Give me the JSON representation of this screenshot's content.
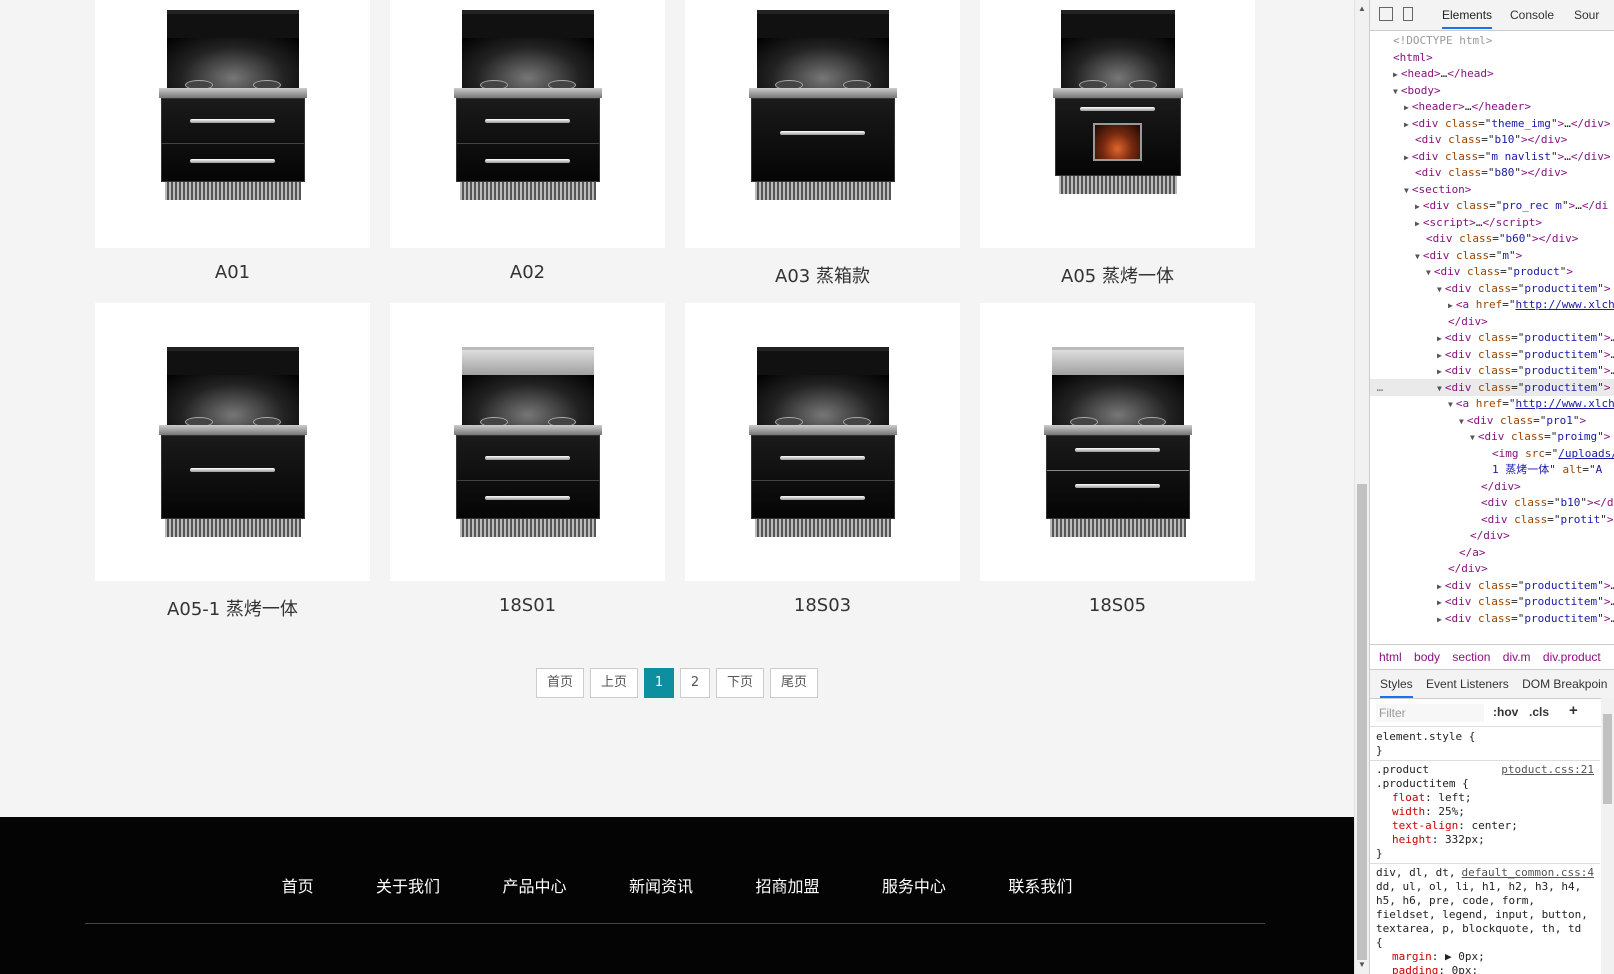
{
  "products": [
    {
      "title": "A01",
      "variant": "hood-2drawer"
    },
    {
      "title": "A02",
      "variant": "hood-2drawer"
    },
    {
      "title": "A03 蒸箱款",
      "variant": "hood-oven"
    },
    {
      "title": "A05 蒸烤一体",
      "variant": "tall-fire"
    },
    {
      "title": "A05-1 蒸烤一体",
      "variant": "hood-oven"
    },
    {
      "title": "18S01",
      "variant": "silver-2drawer"
    },
    {
      "title": "18S03",
      "variant": "hood-2drawer-b"
    },
    {
      "title": "18S05",
      "variant": "silver-window"
    }
  ],
  "pagination": {
    "first": "首页",
    "prev": "上页",
    "pages": [
      "1",
      "2"
    ],
    "current": "1",
    "next": "下页",
    "last": "尾页"
  },
  "footer_nav": [
    "首页",
    "关于我们",
    "产品中心",
    "新闻资讯",
    "招商加盟",
    "服务中心",
    "联系我们"
  ],
  "devtools": {
    "tabs": [
      "Elements",
      "Console",
      "Sour"
    ],
    "active_tab": "Elements",
    "tree": [
      {
        "indent": 0,
        "html": "<span class='cm'>&lt;!DOCTYPE html&gt;</span>"
      },
      {
        "indent": 0,
        "html": "<span class='tg'>&lt;html&gt;</span>"
      },
      {
        "indent": 1,
        "tri": "▶",
        "html": "<span class='tg'>&lt;head&gt;</span>…<span class='tg'>&lt;/head&gt;</span>"
      },
      {
        "indent": 1,
        "tri": "▼",
        "html": "<span class='tg'>&lt;body&gt;</span>"
      },
      {
        "indent": 2,
        "tri": "▶",
        "html": "<span class='tg'>&lt;header&gt;</span>…<span class='tg'>&lt;/header&gt;</span>"
      },
      {
        "indent": 2,
        "tri": "▶",
        "html": "<span class='tg'>&lt;div </span><span class='an'>class</span>=\"<span class='av'>theme_img</span>\"<span class='tg'>&gt;</span>…<span class='tg'>&lt;/div&gt;</span>"
      },
      {
        "indent": 2,
        "html": "<span class='tg'>&lt;div </span><span class='an'>class</span>=\"<span class='av'>b10</span>\"<span class='tg'>&gt;&lt;/div&gt;</span>"
      },
      {
        "indent": 2,
        "tri": "▶",
        "html": "<span class='tg'>&lt;div </span><span class='an'>class</span>=\"<span class='av'>m navlist</span>\"<span class='tg'>&gt;</span>…<span class='tg'>&lt;/div&gt;</span>"
      },
      {
        "indent": 2,
        "html": "<span class='tg'>&lt;div </span><span class='an'>class</span>=\"<span class='av'>b80</span>\"<span class='tg'>&gt;&lt;/div&gt;</span>"
      },
      {
        "indent": 2,
        "tri": "▼",
        "html": "<span class='tg'>&lt;section&gt;</span>"
      },
      {
        "indent": 3,
        "tri": "▶",
        "html": "<span class='tg'>&lt;div </span><span class='an'>class</span>=\"<span class='av'>pro_rec  m</span>\"<span class='tg'>&gt;</span>…<span class='tg'>&lt;/di</span>"
      },
      {
        "indent": 3,
        "tri": "▶",
        "html": "<span class='tg'>&lt;script&gt;</span>…<span class='tg'>&lt;/script&gt;</span>"
      },
      {
        "indent": 3,
        "html": "<span class='tg'>&lt;div </span><span class='an'>class</span>=\"<span class='av'>b60</span>\"<span class='tg'>&gt;&lt;/div&gt;</span>"
      },
      {
        "indent": 3,
        "tri": "▼",
        "html": "<span class='tg'>&lt;div </span><span class='an'>class</span>=\"<span class='av'>m</span>\"<span class='tg'>&gt;</span>"
      },
      {
        "indent": 4,
        "tri": "▼",
        "html": "<span class='tg'>&lt;div </span><span class='an'>class</span>=\"<span class='av'>product</span>\"<span class='tg'>&gt;</span>"
      },
      {
        "indent": 5,
        "tri": "▼",
        "html": "<span class='tg'>&lt;div </span><span class='an'>class</span>=\"<span class='av'>productitem</span>\"<span class='tg'>&gt;</span>"
      },
      {
        "indent": 6,
        "tri": "▶",
        "html": "<span class='tg'>&lt;a </span><span class='an'>href</span>=\"<span class='lk'>http://www.xlch</span>"
      },
      {
        "indent": 5,
        "html": "<span class='tg'>&lt;/div&gt;</span>"
      },
      {
        "indent": 5,
        "tri": "▶",
        "html": "<span class='tg'>&lt;div </span><span class='an'>class</span>=\"<span class='av'>productitem</span>\"<span class='tg'>&gt;</span>…"
      },
      {
        "indent": 5,
        "tri": "▶",
        "html": "<span class='tg'>&lt;div </span><span class='an'>class</span>=\"<span class='av'>productitem</span>\"<span class='tg'>&gt;</span>…"
      },
      {
        "indent": 5,
        "tri": "▶",
        "html": "<span class='tg'>&lt;div </span><span class='an'>class</span>=\"<span class='av'>productitem</span>\"<span class='tg'>&gt;</span>…"
      },
      {
        "indent": 5,
        "tri": "▼",
        "sel": true,
        "html": "<span class='tg'>&lt;div </span><span class='an'>class</span>=\"<span class='av'>productitem</span>\"<span class='tg'>&gt;</span>"
      },
      {
        "indent": 6,
        "tri": "▼",
        "html": "<span class='tg'>&lt;a </span><span class='an'>href</span>=\"<span class='lk'>http://www.xlch</span>"
      },
      {
        "indent": 7,
        "tri": "▼",
        "html": "<span class='tg'>&lt;div </span><span class='an'>class</span>=\"<span class='av'>pro1</span>\"<span class='tg'>&gt;</span>"
      },
      {
        "indent": 8,
        "tri": "▼",
        "html": "<span class='tg'>&lt;div </span><span class='an'>class</span>=\"<span class='av'>proimg</span>\"<span class='tg'>&gt;</span>"
      },
      {
        "indent": 9,
        "html": "<span class='tg'>&lt;img </span><span class='an'>src</span>=\"<span class='lk'>/uploads/</span>"
      },
      {
        "indent": 9,
        "html": "<span class='av'>1 蒸烤一体</span>\" <span class='an'>alt</span>=\"<span class='av'>A</span>"
      },
      {
        "indent": 8,
        "html": "<span class='tg'>&lt;/div&gt;</span>"
      },
      {
        "indent": 8,
        "html": "<span class='tg'>&lt;div </span><span class='an'>class</span>=\"<span class='av'>b10</span>\"<span class='tg'>&gt;&lt;/d</span>"
      },
      {
        "indent": 8,
        "html": "<span class='tg'>&lt;div </span><span class='an'>class</span>=\"<span class='av'>protit</span>\"<span class='tg'>&gt;</span>…"
      },
      {
        "indent": 7,
        "html": "<span class='tg'>&lt;/div&gt;</span>"
      },
      {
        "indent": 6,
        "html": "<span class='tg'>&lt;/a&gt;</span>"
      },
      {
        "indent": 5,
        "html": "<span class='tg'>&lt;/div&gt;</span>"
      },
      {
        "indent": 5,
        "tri": "▶",
        "html": "<span class='tg'>&lt;div </span><span class='an'>class</span>=\"<span class='av'>productitem</span>\"<span class='tg'>&gt;</span>…"
      },
      {
        "indent": 5,
        "tri": "▶",
        "html": "<span class='tg'>&lt;div </span><span class='an'>class</span>=\"<span class='av'>productitem</span>\"<span class='tg'>&gt;</span>…"
      },
      {
        "indent": 5,
        "tri": "▶",
        "html": "<span class='tg'>&lt;div </span><span class='an'>class</span>=\"<span class='av'>productitem</span>\"<span class='tg'>&gt;</span>…"
      }
    ],
    "breadcrumbs": [
      "html",
      "body",
      "section",
      "div.m",
      "div.product"
    ],
    "subtabs": [
      "Styles",
      "Event Listeners",
      "DOM Breakpoin"
    ],
    "filter_placeholder": "Filter",
    "filter_buttons": [
      ":hov",
      ".cls",
      "+"
    ],
    "styles": {
      "element_style": "element.style {",
      "rule1_selector": ".product .productitem {",
      "rule1_source": "ptoduct.css:21",
      "rule1_props": [
        [
          "float",
          "left"
        ],
        [
          "width",
          "25%"
        ],
        [
          "text-align",
          "center"
        ],
        [
          "height",
          "332px"
        ]
      ],
      "rule2_selector": "div, dl, dt, dd, ul, ol, li, h1, h2, h3, h4, h5, h6, pre, code, form, fieldset, legend, input, button, textarea, p, blockquote, th, td {",
      "rule2_source": "default_common.css:4",
      "rule2_props": [
        [
          "margin",
          "▶ 0px"
        ],
        [
          "padding",
          "0px"
        ]
      ]
    }
  }
}
